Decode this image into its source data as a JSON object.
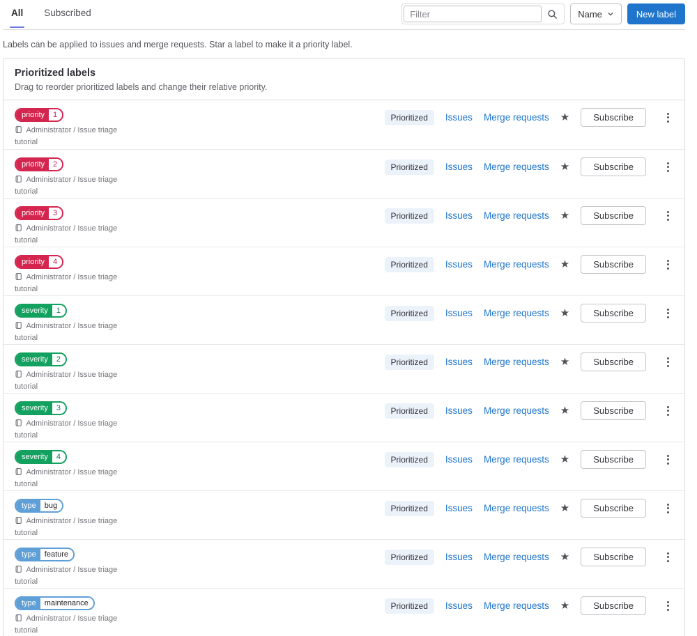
{
  "tabs": [
    {
      "label": "All",
      "active": true
    },
    {
      "label": "Subscribed",
      "active": false
    }
  ],
  "toolbar": {
    "filter_placeholder": "Filter",
    "sort_label": "Name",
    "new_label_button": "New label"
  },
  "icons": {
    "star": "★"
  },
  "description": "Labels can be applied to issues and merge requests. Star a label to make it a priority label.",
  "card": {
    "title": "Prioritized labels",
    "subtitle": "Drag to reorder prioritized labels and change their relative priority."
  },
  "row_common": {
    "project_path": "Administrator / Issue triage tutorial",
    "prioritized_badge": "Prioritized",
    "issues_link": "Issues",
    "merge_requests_link": "Merge requests",
    "subscribe_button": "Subscribe"
  },
  "colors": {
    "accent_blue": "#1f75cb",
    "tab_indicator": "#6e7ce0",
    "label_red": "#d4254e",
    "label_green": "#13a15f",
    "label_blue": "#5f9fd7"
  },
  "labels": [
    {
      "scope": "priority",
      "value": "1",
      "color": "#d4254e",
      "value_color": "#c31e47"
    },
    {
      "scope": "priority",
      "value": "2",
      "color": "#d4254e",
      "value_color": "#c31e47"
    },
    {
      "scope": "priority",
      "value": "3",
      "color": "#d4254e",
      "value_color": "#c31e47"
    },
    {
      "scope": "priority",
      "value": "4",
      "color": "#d4254e",
      "value_color": "#c31e47"
    },
    {
      "scope": "severity",
      "value": "1",
      "color": "#13a15f",
      "value_color": "#0f7a4a"
    },
    {
      "scope": "severity",
      "value": "2",
      "color": "#13a15f",
      "value_color": "#0f7a4a"
    },
    {
      "scope": "severity",
      "value": "3",
      "color": "#13a15f",
      "value_color": "#0f7a4a"
    },
    {
      "scope": "severity",
      "value": "4",
      "color": "#13a15f",
      "value_color": "#0f7a4a"
    },
    {
      "scope": "type",
      "value": "bug",
      "color": "#5f9fd7",
      "value_color": "#28272d"
    },
    {
      "scope": "type",
      "value": "feature",
      "color": "#5f9fd7",
      "value_color": "#28272d"
    },
    {
      "scope": "type",
      "value": "maintenance",
      "color": "#5f9fd7",
      "value_color": "#28272d"
    }
  ]
}
